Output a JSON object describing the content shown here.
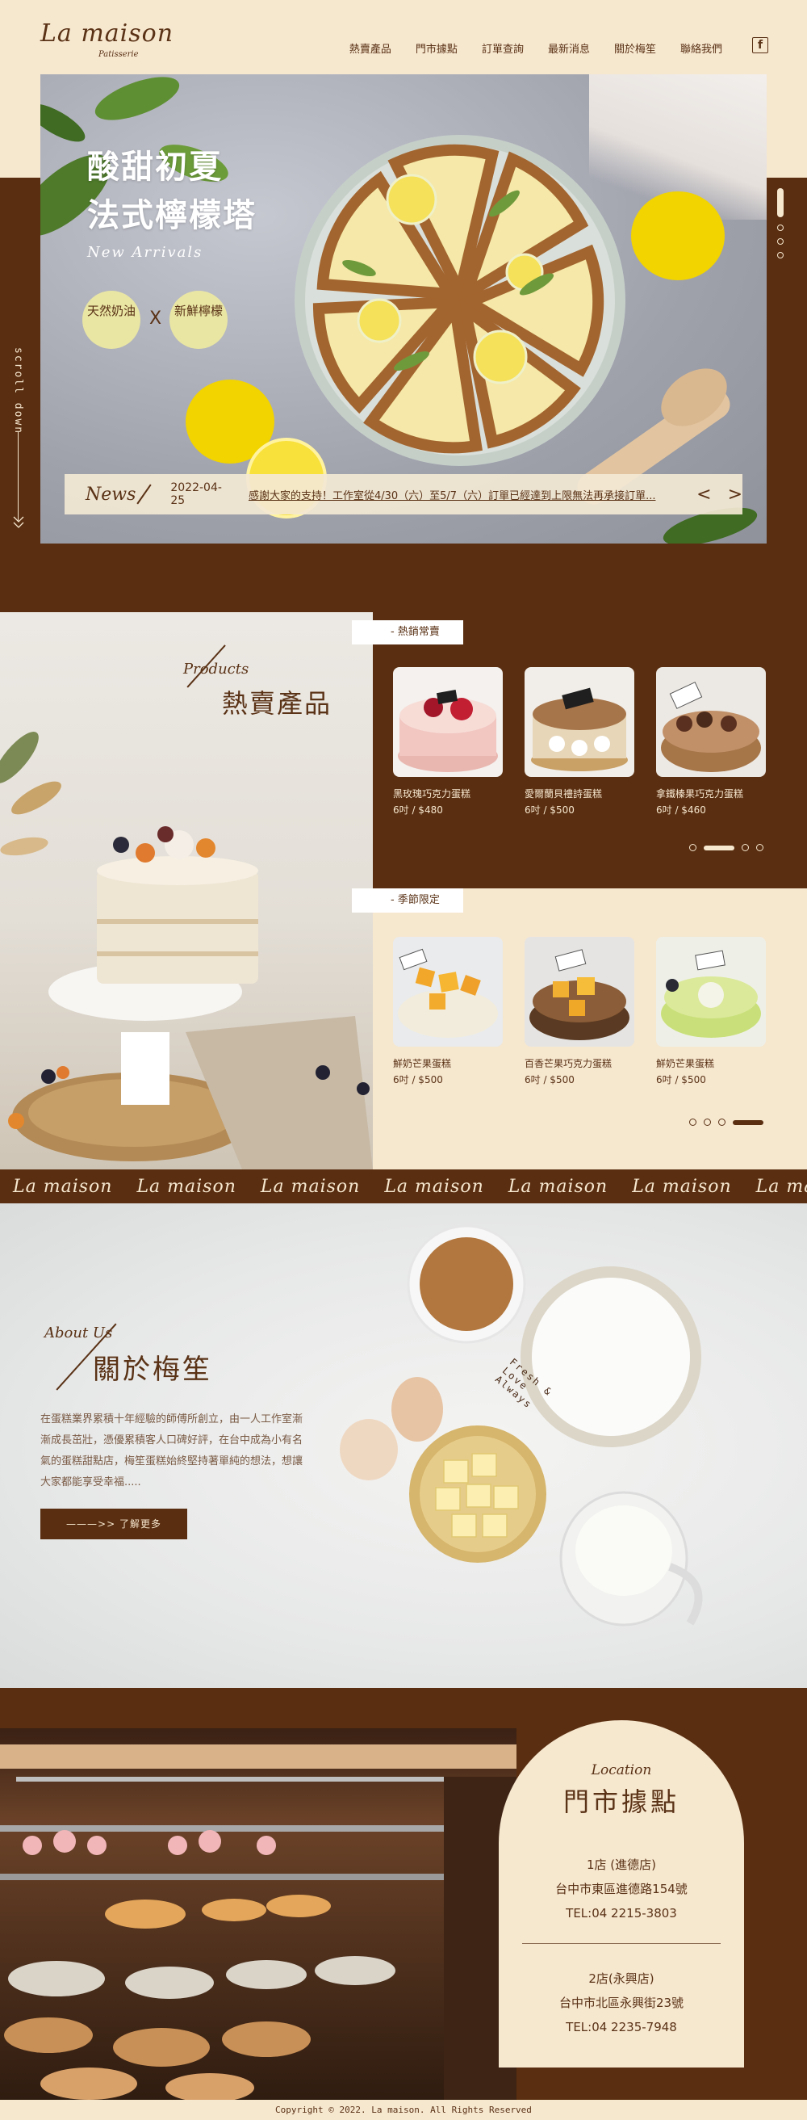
{
  "brand": {
    "logo_main": "La maison",
    "logo_sub": "Patisserie"
  },
  "nav": {
    "items": [
      "熱賣產品",
      "門市據點",
      "訂單查詢",
      "最新消息",
      "關於梅笙",
      "聯絡我們"
    ],
    "facebook_icon": "f"
  },
  "hero": {
    "title_line1": "酸甜初夏",
    "title_line2": "法式檸檬塔",
    "script": "New Arrivals",
    "badge1": "天然奶油",
    "badge2": "新鮮檸檬",
    "badge_separator": "X",
    "news_label": "News",
    "news_date": "2022-04-25",
    "news_text": "感謝大家的支持！工作室從4/30（六）至5/7（六）訂單已經達到上限無法再承接訂單...",
    "prev_arrow": "<",
    "next_arrow": ">",
    "scroll_down": "scroll down"
  },
  "products": {
    "script": "Products",
    "title": "熱賣產品",
    "groups": [
      {
        "tag": "- 熱銷常賣",
        "items": [
          {
            "name": "黑玫瑰巧克力蛋糕",
            "price": "6吋 / $480"
          },
          {
            "name": "愛爾蘭貝禮詩蛋糕",
            "price": "6吋 / $500"
          },
          {
            "name": "拿鐵榛果巧克力蛋糕",
            "price": "6吋 / $460"
          }
        ]
      },
      {
        "tag": "- 季節限定",
        "items": [
          {
            "name": "鮮奶芒果蛋糕",
            "price": "6吋 / $500"
          },
          {
            "name": "百香芒果巧克力蛋糕",
            "price": "6吋 / $500"
          },
          {
            "name": "鮮奶芒果蛋糕",
            "price": "6吋 / $500"
          }
        ]
      }
    ]
  },
  "marquee": {
    "items": [
      "La maison",
      "La maison",
      "La maison",
      "La maison",
      "La maison",
      "La maison",
      "La maison"
    ]
  },
  "about": {
    "script": "About Us",
    "title": "關於梅笙",
    "text": "在蛋糕業界累積十年經驗的師傅所創立，由一人工作室漸漸成長茁壯，憑優累積客人口碑好評，在台中成為小有名氣的蛋糕甜點店，梅笙蛋糕始終堅持著單純的想法，想讓大家都能享受幸福.....",
    "button": "———>>  了解更多",
    "circle_text": "Fresh & Love Always"
  },
  "location": {
    "script": "Location",
    "title": "門市據點",
    "stores": [
      {
        "name": "1店 (進德店)",
        "address": "台中市東區進德路154號",
        "tel": "TEL:04 2215-3803"
      },
      {
        "name": "2店(永興店)",
        "address": "台中市北區永興街23號",
        "tel": "TEL:04 2235-7948"
      }
    ]
  },
  "footer": {
    "copyright": "Copyright © 2022. La maison. All Rights Reserved"
  },
  "colors": {
    "brown": "#5a2e10",
    "cream": "#f6e7cf",
    "lemon_badge": "#e9e6a4"
  }
}
